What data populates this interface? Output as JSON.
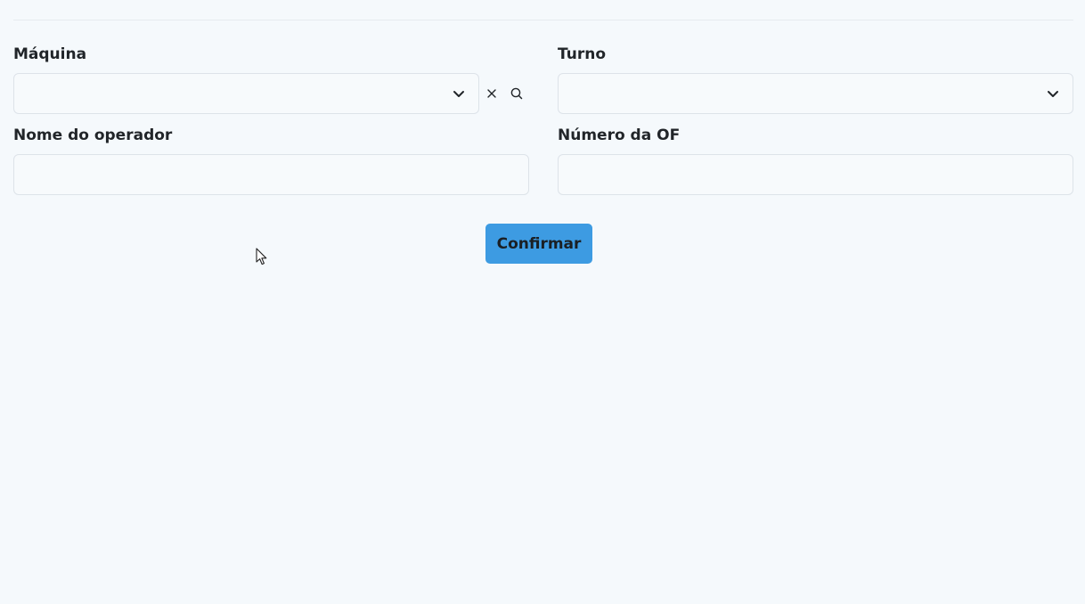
{
  "form": {
    "maquina": {
      "label": "Máquina",
      "value": ""
    },
    "turno": {
      "label": "Turno",
      "value": ""
    },
    "operador": {
      "label": "Nome do operador",
      "value": ""
    },
    "numero_of": {
      "label": "Número da OF",
      "value": ""
    },
    "confirm_label": "Confirmar"
  },
  "icons": {
    "dropdown": "chevron-down-icon",
    "clear": "close-icon",
    "search": "search-icon",
    "pointer": "mouse-cursor-icon"
  },
  "colors": {
    "background": "#f5f9fc",
    "primary": "#3d9be2",
    "border": "#dde3e9"
  }
}
